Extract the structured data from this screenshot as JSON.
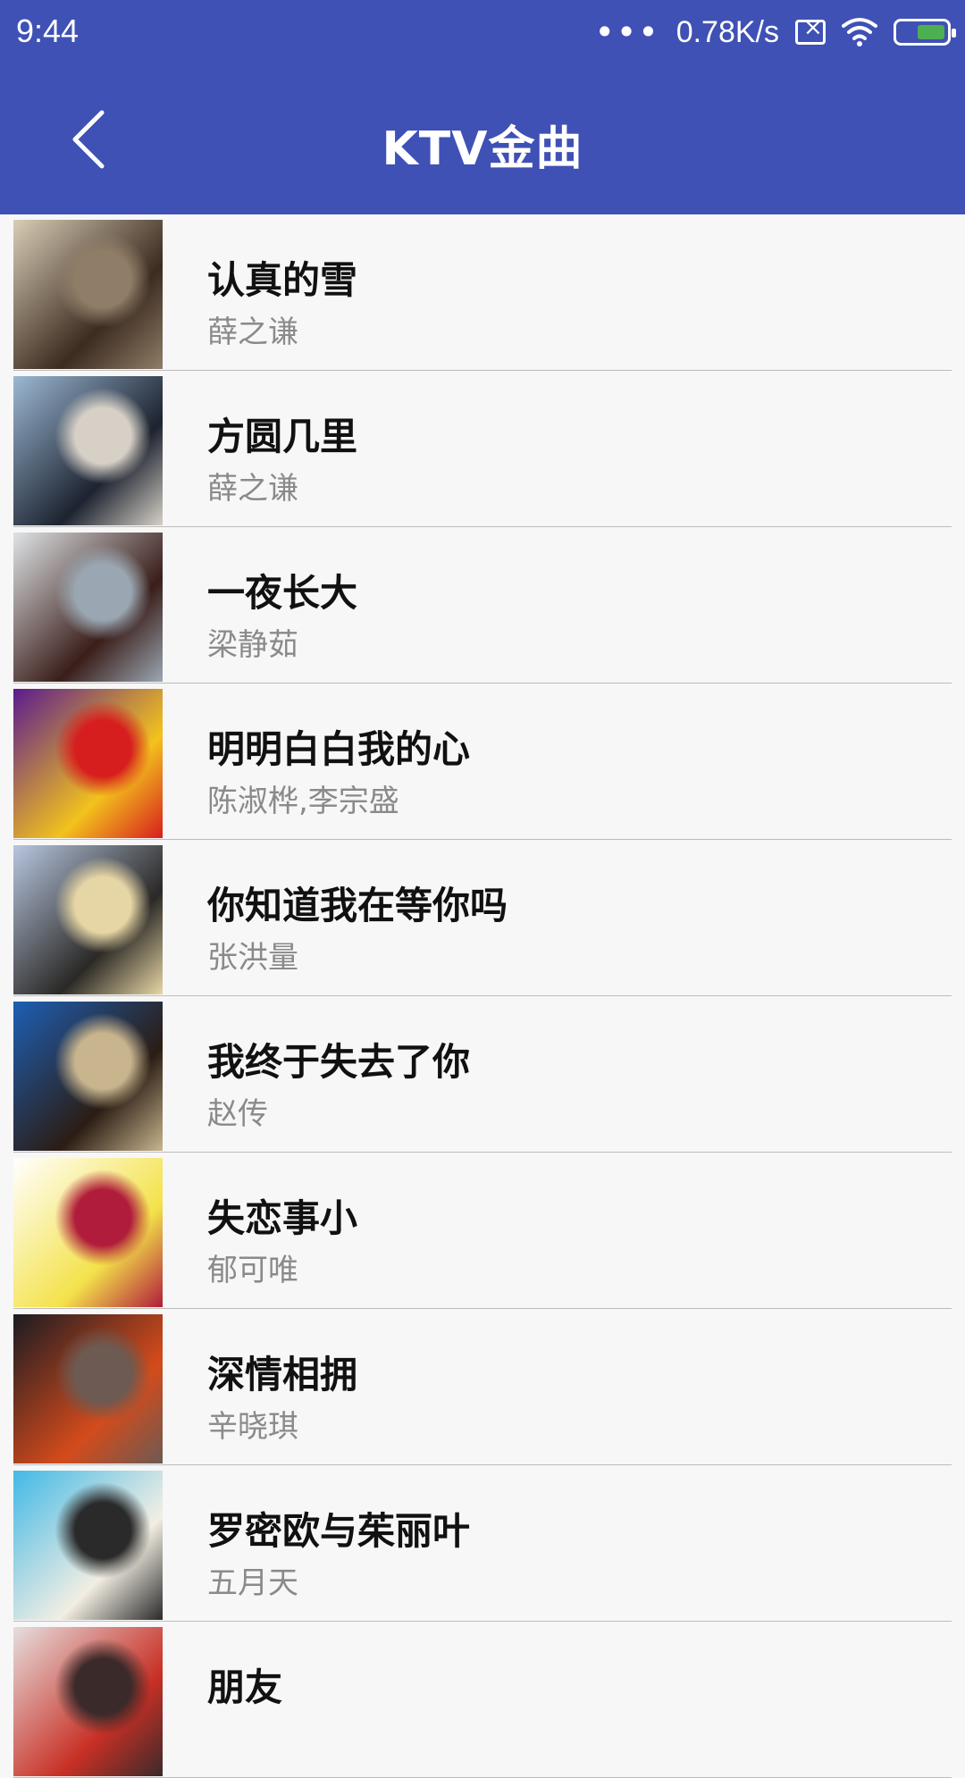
{
  "status": {
    "time": "9:44",
    "speed": "0.78K/s",
    "icons": [
      "more-dots-icon",
      "network-x-icon",
      "wifi-icon",
      "battery-charging-icon"
    ]
  },
  "header": {
    "title": "KTV金曲",
    "back_icon": "chevron-left-icon"
  },
  "songs": [
    {
      "title": "认真的雪",
      "artist": "薛之谦",
      "cover_colors": [
        "#d9cdb6",
        "#3b2b20",
        "#8f7d67"
      ]
    },
    {
      "title": "方圆几里",
      "artist": "薛之谦",
      "cover_colors": [
        "#9bb8d3",
        "#1d2330",
        "#d6d0c6"
      ]
    },
    {
      "title": "一夜长大",
      "artist": "梁静茹",
      "cover_colors": [
        "#dfe3e6",
        "#3a1e1a",
        "#9aa7b2"
      ]
    },
    {
      "title": "明明白白我的心",
      "artist": "陈淑桦,李宗盛",
      "cover_colors": [
        "#5b1b8e",
        "#f2c21d",
        "#d71e1e"
      ]
    },
    {
      "title": "你知道我在等你吗",
      "artist": "张洪量",
      "cover_colors": [
        "#b7c6e0",
        "#2b2926",
        "#e7d6a5"
      ]
    },
    {
      "title": "我终于失去了你",
      "artist": "赵传",
      "cover_colors": [
        "#1e5fb5",
        "#2b1d14",
        "#c8b58e"
      ]
    },
    {
      "title": "失恋事小",
      "artist": "郁可唯",
      "cover_colors": [
        "#ffffff",
        "#f4e24a",
        "#b01c3b"
      ]
    },
    {
      "title": "深情相拥",
      "artist": "辛晓琪",
      "cover_colors": [
        "#1b1b22",
        "#d44b1b",
        "#6d5a52"
      ]
    },
    {
      "title": "罗密欧与茱丽叶",
      "artist": "五月天",
      "cover_colors": [
        "#42b9e6",
        "#f2eee3",
        "#2a2a2a"
      ]
    },
    {
      "title": "朋友",
      "artist": "",
      "cover_colors": [
        "#e6dede",
        "#c83025",
        "#3b2a2a"
      ]
    }
  ]
}
